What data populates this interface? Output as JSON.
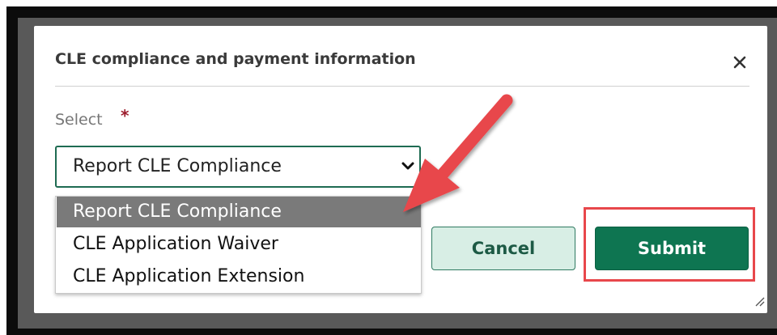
{
  "dialog": {
    "title": "CLE compliance and payment information",
    "close_icon": "close-icon"
  },
  "form": {
    "select_label": "Select",
    "required_marker": "*",
    "selected_value": "Report CLE Compliance",
    "options": [
      "Report CLE Compliance",
      "CLE Application Waiver",
      "CLE Application Extension"
    ]
  },
  "buttons": {
    "cancel": "Cancel",
    "submit": "Submit"
  },
  "colors": {
    "accent": "#0e7551",
    "annotation": "#e8474b"
  }
}
